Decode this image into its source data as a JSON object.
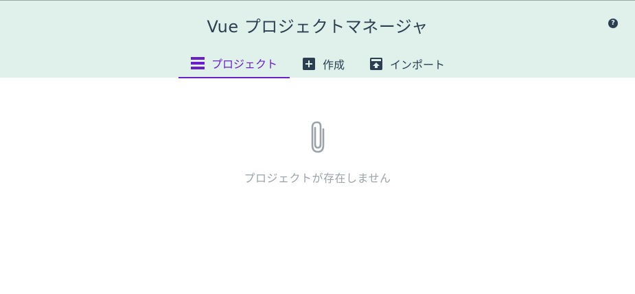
{
  "app": {
    "title": "Vue プロジェクトマネージャ"
  },
  "header": {
    "help_icon": "help-icon",
    "help_glyph": "?"
  },
  "tabs": [
    {
      "label": "プロジェクト",
      "icon": "list-icon",
      "active": true
    },
    {
      "label": "作成",
      "icon": "add-icon",
      "active": false
    },
    {
      "label": "インポート",
      "icon": "import-icon",
      "active": false
    }
  ],
  "empty_state": {
    "icon": "paperclip-icon",
    "message": "プロジェクトが存在しません"
  },
  "colors": {
    "header_bg": "#dff1ea",
    "accent": "#6a1fc7",
    "text": "#2c3e50",
    "muted": "#9ca3a8"
  }
}
